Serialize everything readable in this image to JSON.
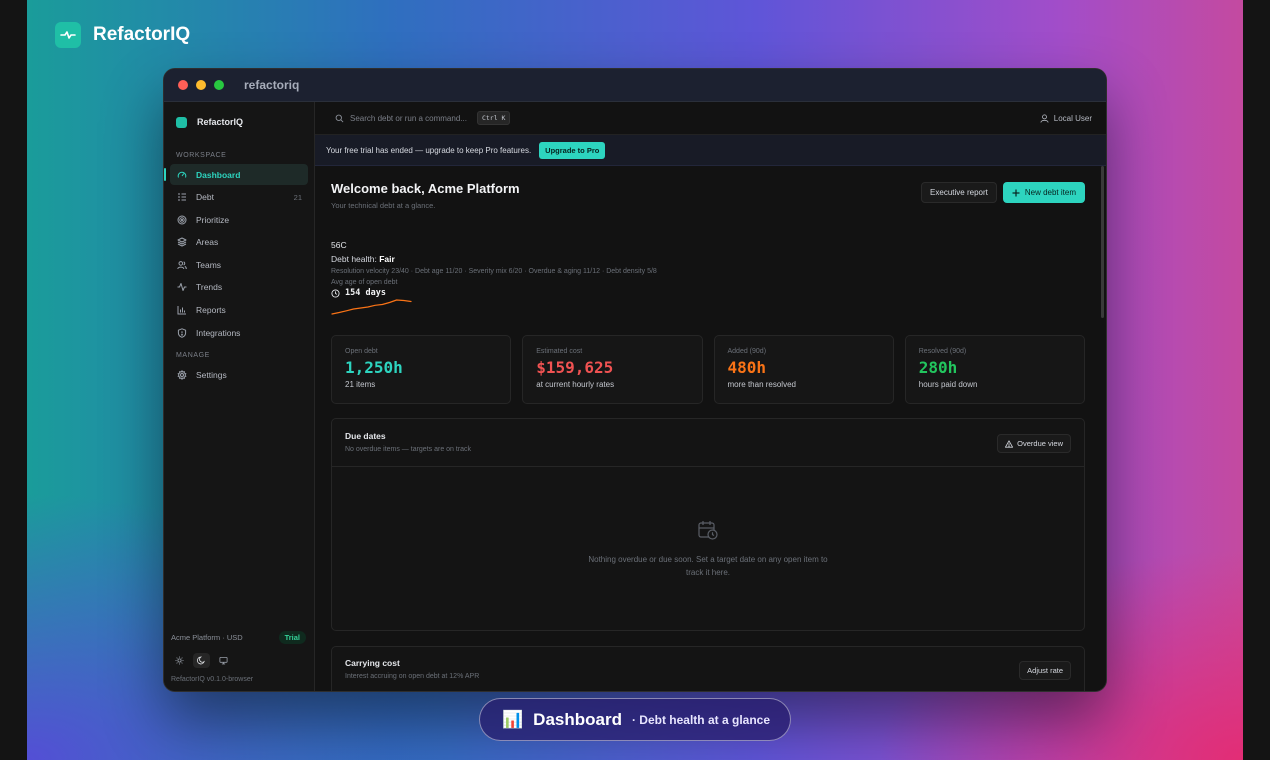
{
  "brand": {
    "name": "RefactorIQ"
  },
  "window": {
    "title": "refactoriq"
  },
  "sidebar": {
    "brand_name": "RefactorIQ",
    "workspace_label": "WORKSPACE",
    "manage_label": "MANAGE",
    "items": [
      {
        "label": "Dashboard",
        "icon": "gauge-icon"
      },
      {
        "label": "Debt",
        "icon": "list-icon",
        "count": "21"
      },
      {
        "label": "Prioritize",
        "icon": "target-icon"
      },
      {
        "label": "Areas",
        "icon": "layers-icon"
      },
      {
        "label": "Teams",
        "icon": "users-icon"
      },
      {
        "label": "Trends",
        "icon": "activity-icon"
      },
      {
        "label": "Reports",
        "icon": "bar-chart-icon"
      },
      {
        "label": "Integrations",
        "icon": "shield-icon"
      }
    ],
    "manage_items": [
      {
        "label": "Settings",
        "icon": "gear-icon"
      }
    ],
    "footer": {
      "org": "Acme Platform · USD",
      "badge": "Trial",
      "version": "RefactorIQ v0.1.0-browser"
    }
  },
  "topbar": {
    "search_placeholder": "Search debt or run a command...",
    "shortcut": "Ctrl K",
    "user": "Local User"
  },
  "trial_banner": {
    "text": "Your free trial has ended — upgrade to keep Pro features.",
    "button": "Upgrade to Pro"
  },
  "dashboard": {
    "title": "Welcome back, Acme Platform",
    "subtitle": "Your technical debt at a glance.",
    "executive_report": "Executive report",
    "new_item": "New debt item",
    "health": {
      "score": "56C",
      "label_prefix": "Debt health: ",
      "label_value": "Fair",
      "breakdown": "Resolution velocity 23/40 · Debt age 11/20 · Severity mix 6/20 · Overdue & aging 11/12 · Debt density 5/8",
      "avg_age_label": "Avg age of open debt",
      "avg_age_value": "154 days",
      "trend": [
        3,
        3.6,
        4.3,
        5,
        5.4,
        5.8,
        6.5,
        6.8,
        7.6,
        8.6,
        8.4,
        8
      ]
    },
    "stats": [
      {
        "label": "Open debt",
        "value": "1,250h",
        "sub": "21 items",
        "color": "#2dd4bf"
      },
      {
        "label": "Estimated cost",
        "value": "$159,625",
        "sub": "at current hourly rates",
        "color": "#f05252"
      },
      {
        "label": "Added (90d)",
        "value": "480h",
        "sub": "more than resolved",
        "color": "#f97316"
      },
      {
        "label": "Resolved (90d)",
        "value": "280h",
        "sub": "hours paid down",
        "color": "#22c55e"
      }
    ],
    "due_dates": {
      "title": "Due dates",
      "subtitle": "No overdue items — targets are on track",
      "button": "Overdue view",
      "empty": "Nothing overdue or due soon. Set a target date on any open item to track it here."
    },
    "carrying_cost": {
      "title": "Carrying cost",
      "subtitle": "Interest accruing on open debt at 12% APR",
      "button": "Adjust rate"
    }
  },
  "caption": {
    "emoji": "📊",
    "title": "Dashboard",
    "subtitle": "· Debt health at a glance"
  },
  "colors": {
    "accent": "#2dd4bf",
    "spark": "#f97316"
  }
}
